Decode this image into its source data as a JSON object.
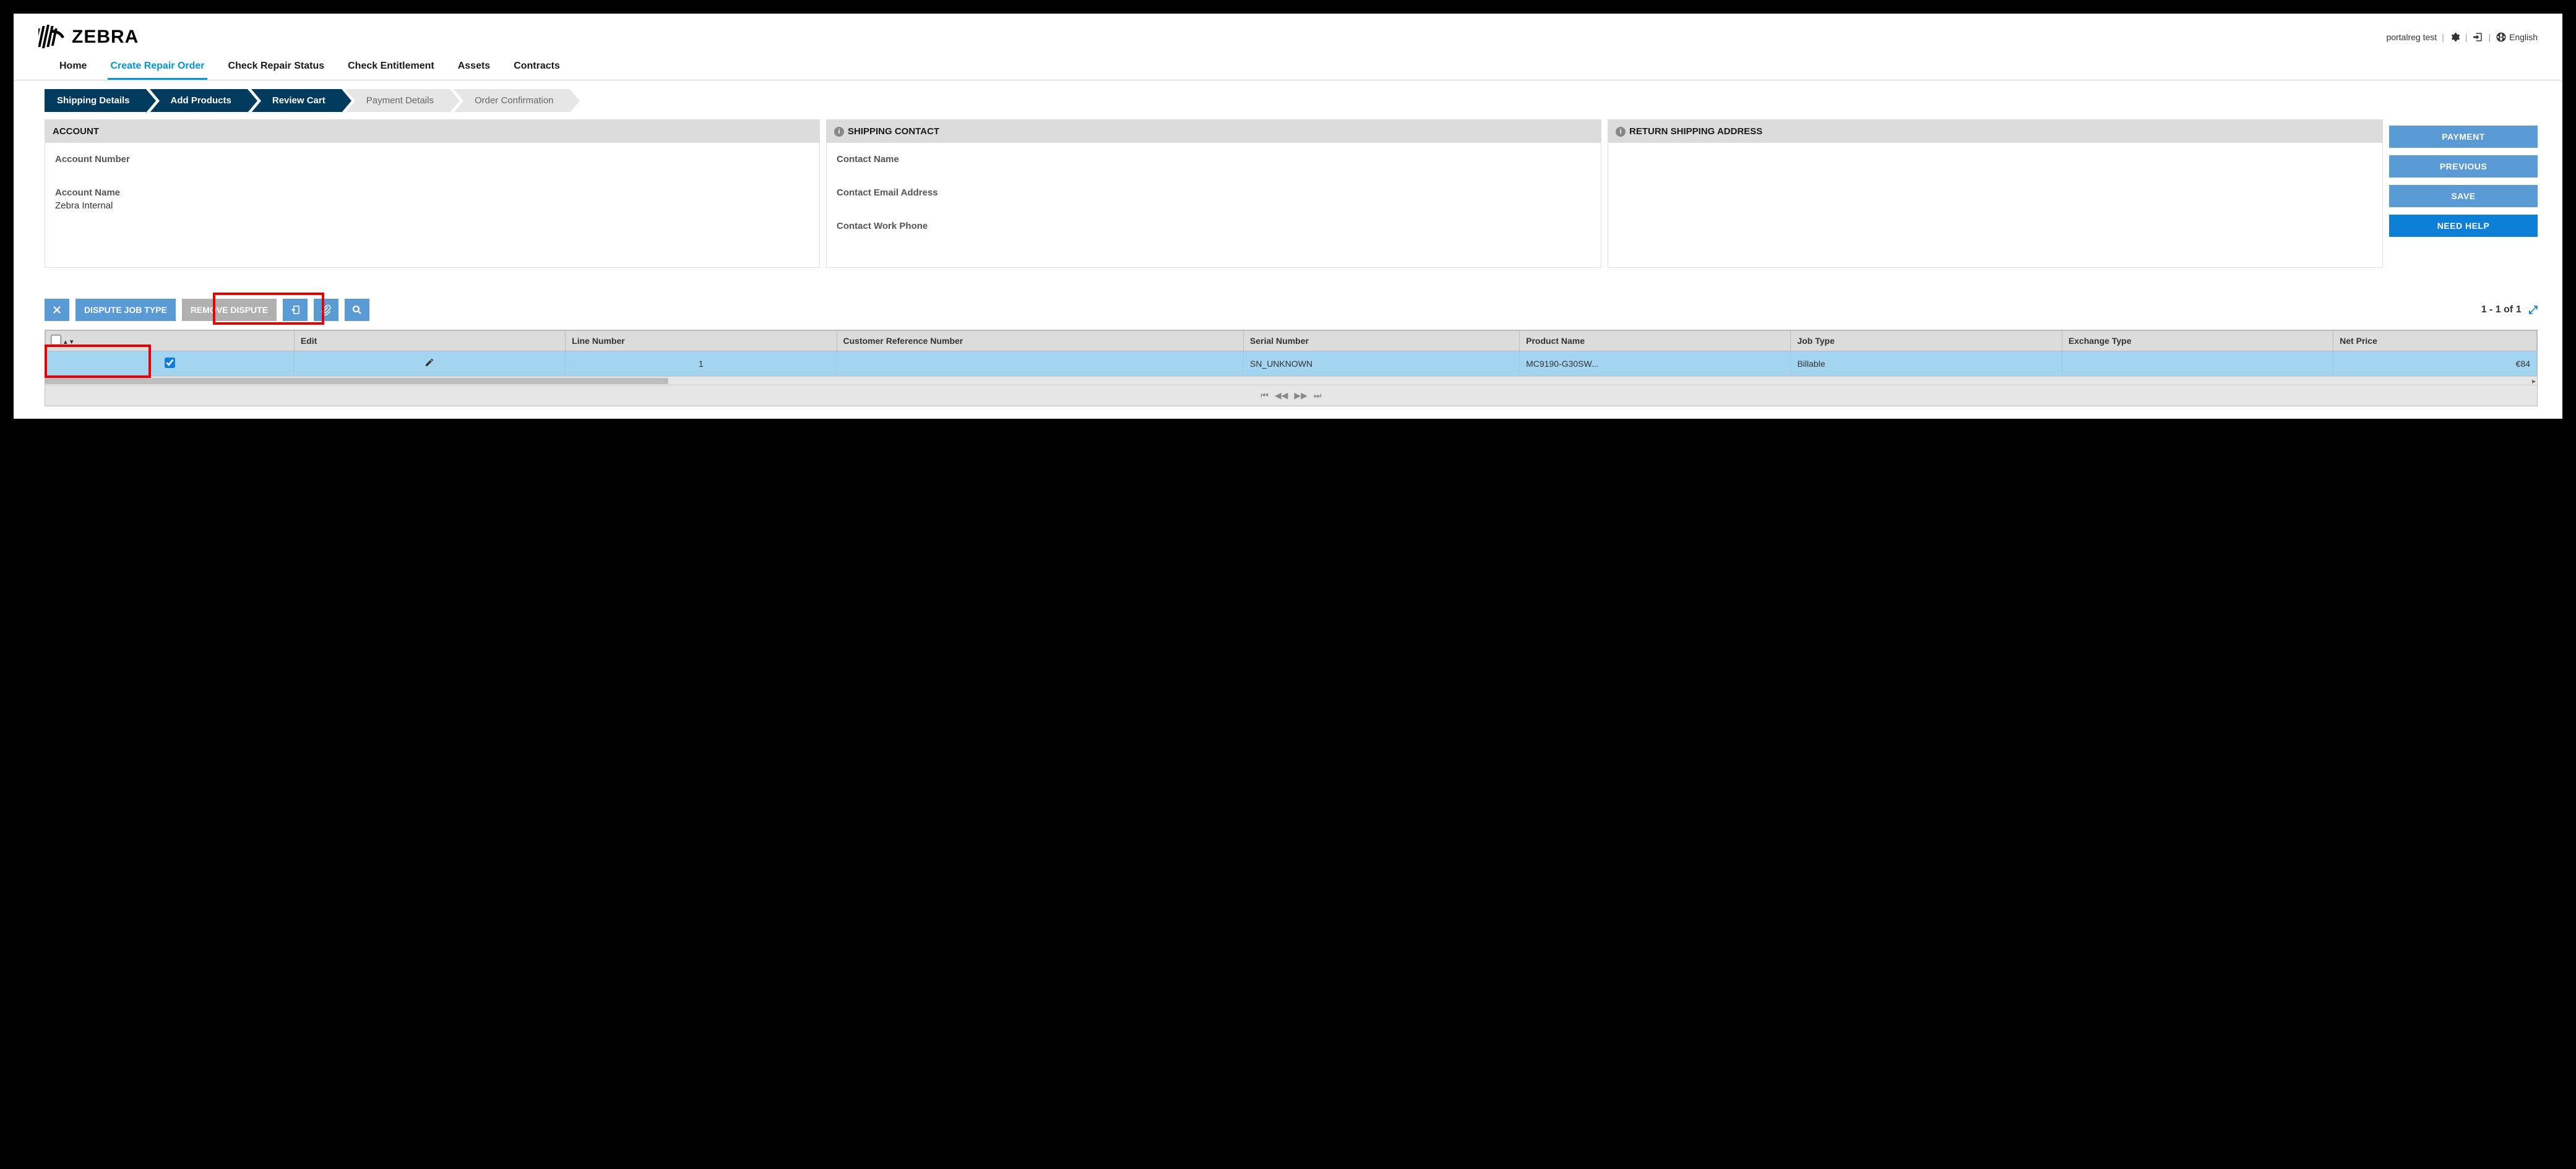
{
  "header": {
    "brand": "ZEBRA",
    "username": "portalreg test",
    "language": "English"
  },
  "nav": {
    "items": [
      "Home",
      "Create Repair Order",
      "Check Repair Status",
      "Check Entitlement",
      "Assets",
      "Contracts"
    ],
    "active_index": 1
  },
  "stepper": {
    "steps": [
      "Shipping Details",
      "Add Products",
      "Review Cart",
      "Payment Details",
      "Order Confirmation"
    ],
    "done_through": 2
  },
  "panels": {
    "account": {
      "title": "ACCOUNT",
      "number_label": "Account Number",
      "name_label": "Account Name",
      "name_value": "Zebra Internal"
    },
    "contact": {
      "title": "SHIPPING CONTACT",
      "name_label": "Contact Name",
      "email_label": "Contact Email Address",
      "phone_label": "Contact Work Phone"
    },
    "return": {
      "title": "RETURN SHIPPING ADDRESS"
    }
  },
  "actions": {
    "payment": "PAYMENT",
    "previous": "PREVIOUS",
    "save": "SAVE",
    "help": "NEED HELP"
  },
  "toolbar": {
    "dispute": "DISPUTE JOB TYPE",
    "remove": "REMOVE DISPUTE"
  },
  "grid": {
    "pager": "1 - 1 of 1",
    "columns": [
      "",
      "Edit",
      "Line Number",
      "Customer Reference Number",
      "Serial Number",
      "Product Name",
      "Job Type",
      "Exchange Type",
      "Net Price"
    ],
    "row": {
      "checked": true,
      "line_number": "1",
      "customer_ref": "",
      "serial": "SN_UNKNOWN",
      "product": "MC9190-G30SW...",
      "job_type": "Billable",
      "exchange": "",
      "net_price": "€84"
    }
  }
}
